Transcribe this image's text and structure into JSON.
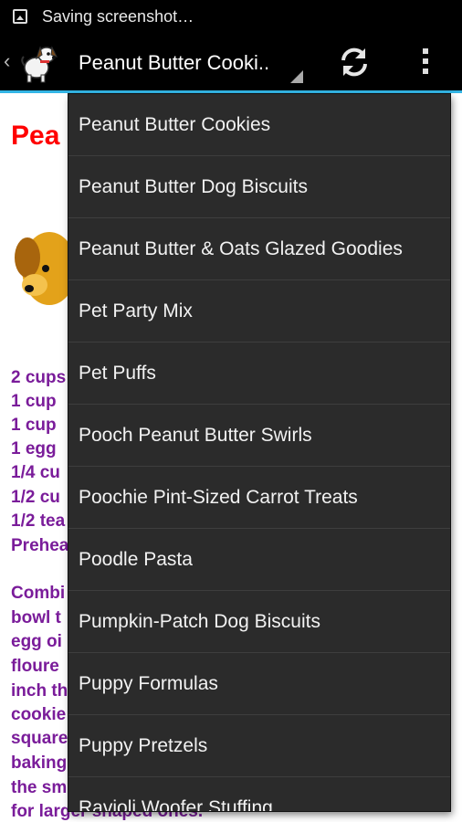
{
  "status_bar": {
    "text": "Saving screenshot…",
    "icon": "image-icon"
  },
  "action_bar": {
    "spinner_label": "Peanut Butter Cooki..",
    "icons": [
      "chevron-left-icon",
      "dog-app-icon",
      "refresh-icon",
      "overflow-menu-icon"
    ],
    "accent_color": "#33b5e5"
  },
  "content": {
    "title": "Pea",
    "title_color": "#ff0000",
    "text_color": "#7a1c9a",
    "ingredients": [
      "2 cups",
      "1 cup",
      "1 cup",
      "1 egg",
      "1/4 cu",
      "1/2 cu",
      "1/2 tea",
      "Prehea"
    ],
    "instructions": [
      "Combi",
      "bowl t",
      "egg oi",
      "floure",
      "inch th",
      "cookie",
      "square",
      "baking",
      "the sm",
      "for larger shaped ones."
    ]
  },
  "dropdown": {
    "items": [
      "Peanut Butter Cookies",
      "Peanut Butter Dog Biscuits",
      "Peanut Butter & Oats Glazed Goodies",
      "Pet Party Mix",
      "Pet Puffs",
      "Pooch Peanut Butter Swirls",
      "Poochie Pint-Sized Carrot Treats",
      "Poodle Pasta",
      "Pumpkin-Patch Dog Biscuits",
      "Puppy Formulas",
      "Puppy Pretzels",
      "Ravioli Woofer Stuffing"
    ]
  }
}
